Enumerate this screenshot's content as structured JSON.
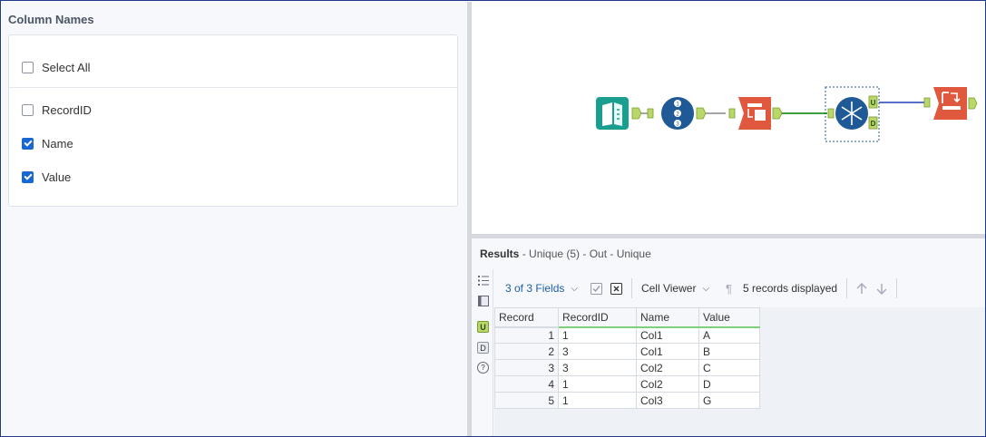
{
  "config": {
    "title": "Column Names",
    "select_all": {
      "label": "Select All",
      "checked": false
    },
    "columns": [
      {
        "label": "RecordID",
        "checked": false
      },
      {
        "label": "Name",
        "checked": true
      },
      {
        "label": "Value",
        "checked": true
      }
    ]
  },
  "canvas": {
    "tools": [
      {
        "name": "input-data-tool",
        "color": "#1a9e8f"
      },
      {
        "name": "record-id-tool",
        "color": "#1f5a96"
      },
      {
        "name": "select-tool",
        "color": "#e0583e"
      },
      {
        "name": "unique-tool",
        "color": "#1f5a96",
        "outputs": [
          "U",
          "D"
        ]
      },
      {
        "name": "browse-tool",
        "color": "#e0583e"
      }
    ]
  },
  "results": {
    "label": "Results",
    "subtitle": " - Unique (5) - Out - Unique",
    "toolbar": {
      "fields": "3 of 3 Fields",
      "cell_viewer": "Cell Viewer",
      "records_displayed": "5 records displayed"
    },
    "sidebar": {
      "u": "U",
      "d": "D",
      "help": "?"
    },
    "columns": [
      "Record",
      "RecordID",
      "Name",
      "Value"
    ],
    "rows": [
      [
        "1",
        "1",
        "Col1",
        "A"
      ],
      [
        "2",
        "3",
        "Col1",
        "B"
      ],
      [
        "3",
        "3",
        "Col2",
        "C"
      ],
      [
        "4",
        "1",
        "Col2",
        "D"
      ],
      [
        "5",
        "1",
        "Col3",
        "G"
      ]
    ]
  }
}
